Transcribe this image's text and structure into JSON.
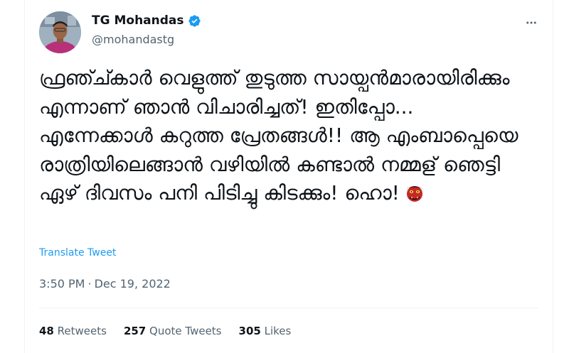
{
  "author": {
    "name": "TG Mohandas",
    "handle": "@mohandastg",
    "verified": true,
    "verified_color": "#1d9bf0"
  },
  "tweet": {
    "text": "ഫ്രഞ്ച്കാർ വെളുത്ത് തുടുത്ത സായ്പൻമാരായിരിക്കും എന്നാണ് ഞാൻ വിചാരിച്ചത്! ഇതിപ്പോ... എന്നേക്കാൾ കറുത്ത പ്രേതങ്ങൾ!! ആ എംബാപ്പെയെ രാത്രിയിലെങ്ങാൻ വഴിയിൽ കണ്ടാൽ നമ്മള് ഞെട്ടി ഏഴ് ദിവസം പനി പിടിച്ചു കിടക്കും! ഹൊ!",
    "emoji": "ogre-emoji",
    "translate_label": "Translate Tweet",
    "time": "3:50 PM",
    "separator": "·",
    "date": "Dec 19, 2022"
  },
  "stats": [
    {
      "count": "48",
      "label": "Retweets"
    },
    {
      "count": "257",
      "label": "Quote Tweets"
    },
    {
      "count": "305",
      "label": "Likes"
    }
  ],
  "colors": {
    "text": "#0f1419",
    "secondary": "#536471",
    "link": "#1d9bf0",
    "border": "#eff3f4"
  }
}
